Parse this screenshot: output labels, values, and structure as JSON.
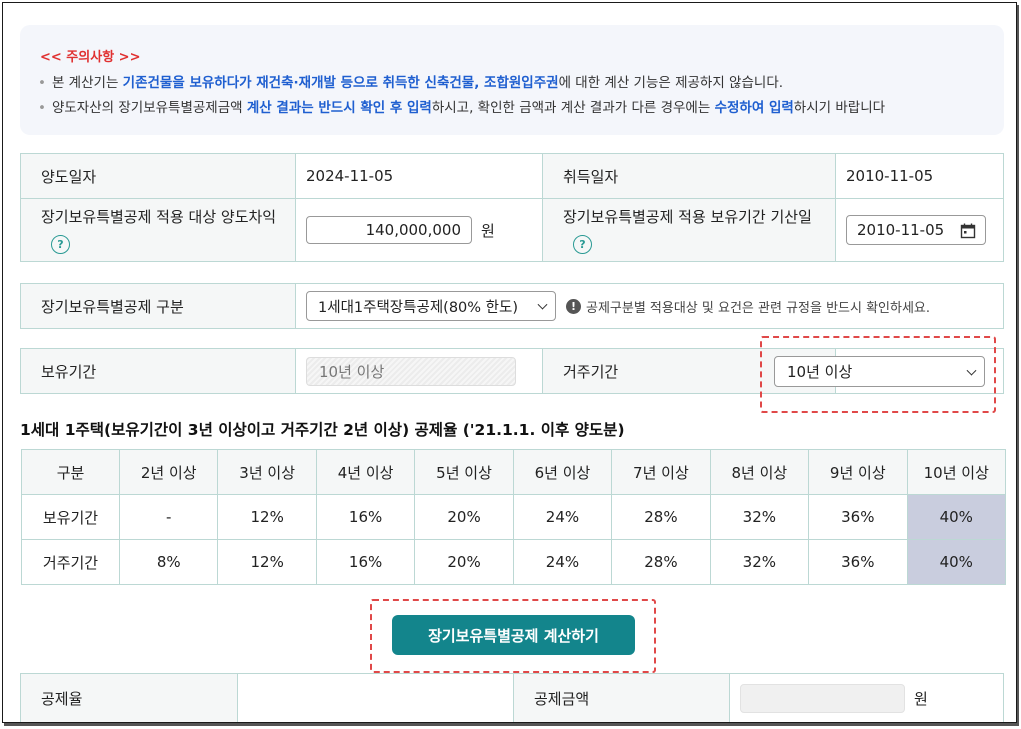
{
  "notice": {
    "title": "<< 주의사항 >>",
    "line1": {
      "p1": "본 계산기는 ",
      "h1": "기존건물을 보유하다가 재건축·재개발 등으로 취득한 신축건물, 조합원입주권",
      "p2": "에 대한 계산 기능은 제공하지 않습니다."
    },
    "line2": {
      "p1": "양도자산의 장기보유특별공제금액 ",
      "h1": "계산 결과는 반드시 확인 후 입력",
      "p2": "하시고, 확인한 금액과 계산 결과가 다른 경우에는 ",
      "h2": "수정하여 입력",
      "p3": "하시기 바랍니다"
    }
  },
  "info": {
    "transfer_date_label": "양도일자",
    "transfer_date": "2024-11-05",
    "acquire_date_label": "취득일자",
    "acquire_date": "2010-11-05",
    "gain_label": "장기보유특별공제 적용 대상 양도차익",
    "gain_value": "140,000,000",
    "gain_unit": "원",
    "base_date_label": "장기보유특별공제 적용 보유기간 기산일",
    "base_date": "2010-11-05",
    "help_glyph": "?"
  },
  "deduction_type": {
    "label": "장기보유특별공제 구분",
    "selected": "1세대1주택장특공제(80% 한도)",
    "warn_glyph": "!",
    "notice": "공제구분별 적용대상 및 요건은 관련 규정을 반드시 확인하세요."
  },
  "periods": {
    "holding_label": "보유기간",
    "holding_value": "10년 이상",
    "residence_label": "거주기간",
    "residence_selected": "10년 이상"
  },
  "rate_table": {
    "title": "1세대 1주택(보유기간이 3년 이상이고 거주기간 2년 이상) 공제율 ('21.1.1. 이후 양도분)",
    "headers": [
      "구분",
      "2년 이상",
      "3년 이상",
      "4년 이상",
      "5년 이상",
      "6년 이상",
      "7년 이상",
      "8년 이상",
      "9년 이상",
      "10년 이상"
    ],
    "rows": [
      {
        "label": "보유기간",
        "values": [
          "-",
          "12%",
          "16%",
          "20%",
          "24%",
          "28%",
          "32%",
          "36%",
          "40%"
        ]
      },
      {
        "label": "거주기간",
        "values": [
          "8%",
          "12%",
          "16%",
          "20%",
          "24%",
          "28%",
          "32%",
          "36%",
          "40%"
        ]
      }
    ],
    "highlight_column": "10년 이상"
  },
  "calculate_button": "장기보유특별공제 계산하기",
  "result": {
    "rate_label": "공제율",
    "rate_value": "",
    "amount_label": "공제금액",
    "amount_value": "",
    "amount_unit": "원"
  },
  "colors": {
    "accent": "#13858c",
    "notice_title": "#e03030",
    "highlight_text": "#1f5fd0",
    "highlight_cell": "#c9cdde",
    "annotation_box": "#e04848"
  }
}
